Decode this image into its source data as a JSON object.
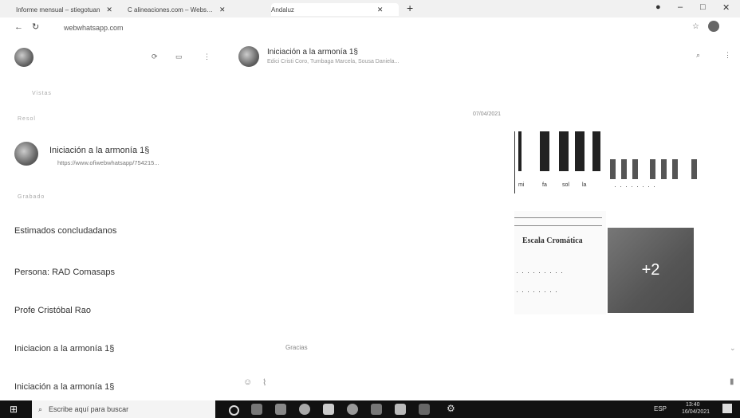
{
  "browser": {
    "tabs": [
      {
        "label": "Informe mensual – stiegotuan"
      },
      {
        "label": "C  alineaciones.com – Webs…"
      },
      {
        "label": "Andaluz"
      }
    ],
    "new_tab": "+",
    "url": "webwhatsapp.com"
  },
  "window_controls": {
    "minimize": "–",
    "maximize": "□",
    "close": "✕"
  },
  "left_panel": {
    "section_label_1": "Vistas",
    "section_label_2": "Resol",
    "group_name": "Iniciación a la armonía 1§",
    "group_link": "https://www.ofiwebwhatsapp/754215...",
    "section_label_3": "Grabado",
    "chats": [
      {
        "title": "Estimados concludadanos"
      },
      {
        "title": "Persona: RAD Comasaps"
      },
      {
        "title": "Profe Cristóbal Rao"
      },
      {
        "title": "Iniciacion a la armonía 1§"
      },
      {
        "title": "Iniciación a la armonía 1§"
      }
    ]
  },
  "chat_header": {
    "title": "Iniciación a la armonía 1§",
    "subtitle": "Edici Cristi Coro, Tumbaga Marcela, Sousa Daniela..."
  },
  "chat": {
    "date_label": "07/04/2021",
    "note_names": [
      "mi",
      "fa",
      "sol",
      "la"
    ],
    "scale_title": "Escala Cromática",
    "more_count": "+2",
    "caption": "Gracias"
  },
  "taskbar": {
    "search_placeholder": "Escribe aquí para buscar",
    "time": "13:40",
    "date": "16/04/2021",
    "lang": "ESP"
  }
}
